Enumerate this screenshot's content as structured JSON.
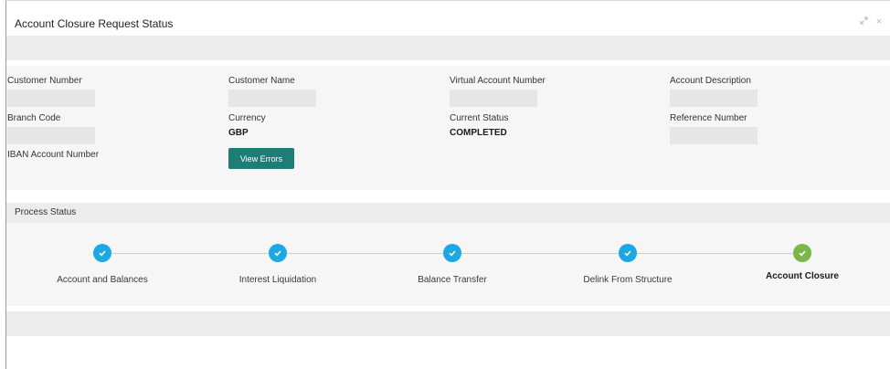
{
  "window": {
    "title": "Account Closure Request Status",
    "controls": {
      "expand_icon": "expand-arrows-icon",
      "close_glyph": "×"
    }
  },
  "details": {
    "customer_number": {
      "label": "Customer Number",
      "value": ""
    },
    "customer_name": {
      "label": "Customer Name",
      "value": ""
    },
    "virtual_account_number": {
      "label": "Virtual Account Number",
      "value": ""
    },
    "account_description": {
      "label": "Account Description",
      "value": ""
    },
    "branch_code": {
      "label": "Branch Code",
      "value": ""
    },
    "currency": {
      "label": "Currency",
      "value": "GBP"
    },
    "current_status": {
      "label": "Current Status",
      "value": "COMPLETED"
    },
    "reference_number": {
      "label": "Reference Number",
      "value": ""
    },
    "iban_account_number": {
      "label": "IBAN Account Number"
    },
    "view_errors_label": "View Errors"
  },
  "process": {
    "title": "Process Status",
    "steps": [
      {
        "label": "Account and Balances",
        "status": "done",
        "color": "#1ea8e0"
      },
      {
        "label": "Interest Liquidation",
        "status": "done",
        "color": "#1ea8e0"
      },
      {
        "label": "Balance Transfer",
        "status": "done",
        "color": "#1ea8e0"
      },
      {
        "label": "Delink From Structure",
        "status": "done",
        "color": "#1ea8e0"
      },
      {
        "label": "Account Closure",
        "status": "current",
        "color": "#7ab648"
      }
    ]
  },
  "colors": {
    "accent_button": "#1f7d78",
    "step_done": "#1ea8e0",
    "step_final": "#7ab648"
  }
}
